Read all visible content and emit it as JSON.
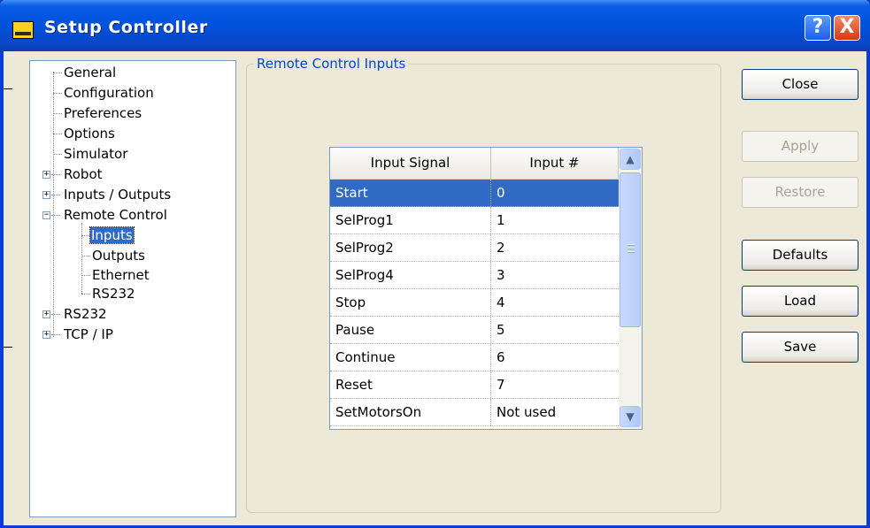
{
  "window": {
    "title": "Setup Controller",
    "help_label": "?",
    "close_label": "X"
  },
  "tree": {
    "general": "General",
    "configuration": "Configuration",
    "preferences": "Preferences",
    "options": "Options",
    "simulator": "Simulator",
    "robot": "Robot",
    "inputs_outputs": "Inputs / Outputs",
    "remote_control": "Remote Control",
    "rc_inputs": "Inputs",
    "rc_outputs": "Outputs",
    "rc_ethernet": "Ethernet",
    "rc_rs232": "RS232",
    "rs232": "RS232",
    "tcpip": "TCP / IP"
  },
  "group": {
    "title": "Remote Control Inputs"
  },
  "grid": {
    "headers": [
      "Input Signal",
      "Input #"
    ],
    "rows": [
      [
        "Start",
        "0"
      ],
      [
        "SelProg1",
        "1"
      ],
      [
        "SelProg2",
        "2"
      ],
      [
        "SelProg4",
        "3"
      ],
      [
        "Stop",
        "4"
      ],
      [
        "Pause",
        "5"
      ],
      [
        "Continue",
        "6"
      ],
      [
        "Reset",
        "7"
      ],
      [
        "SetMotorsOn",
        "Not used"
      ]
    ],
    "selected_row": "Start"
  },
  "buttons": {
    "close": "Close",
    "apply": "Apply",
    "restore": "Restore",
    "defaults": "Defaults",
    "load": "Load",
    "save": "Save"
  }
}
